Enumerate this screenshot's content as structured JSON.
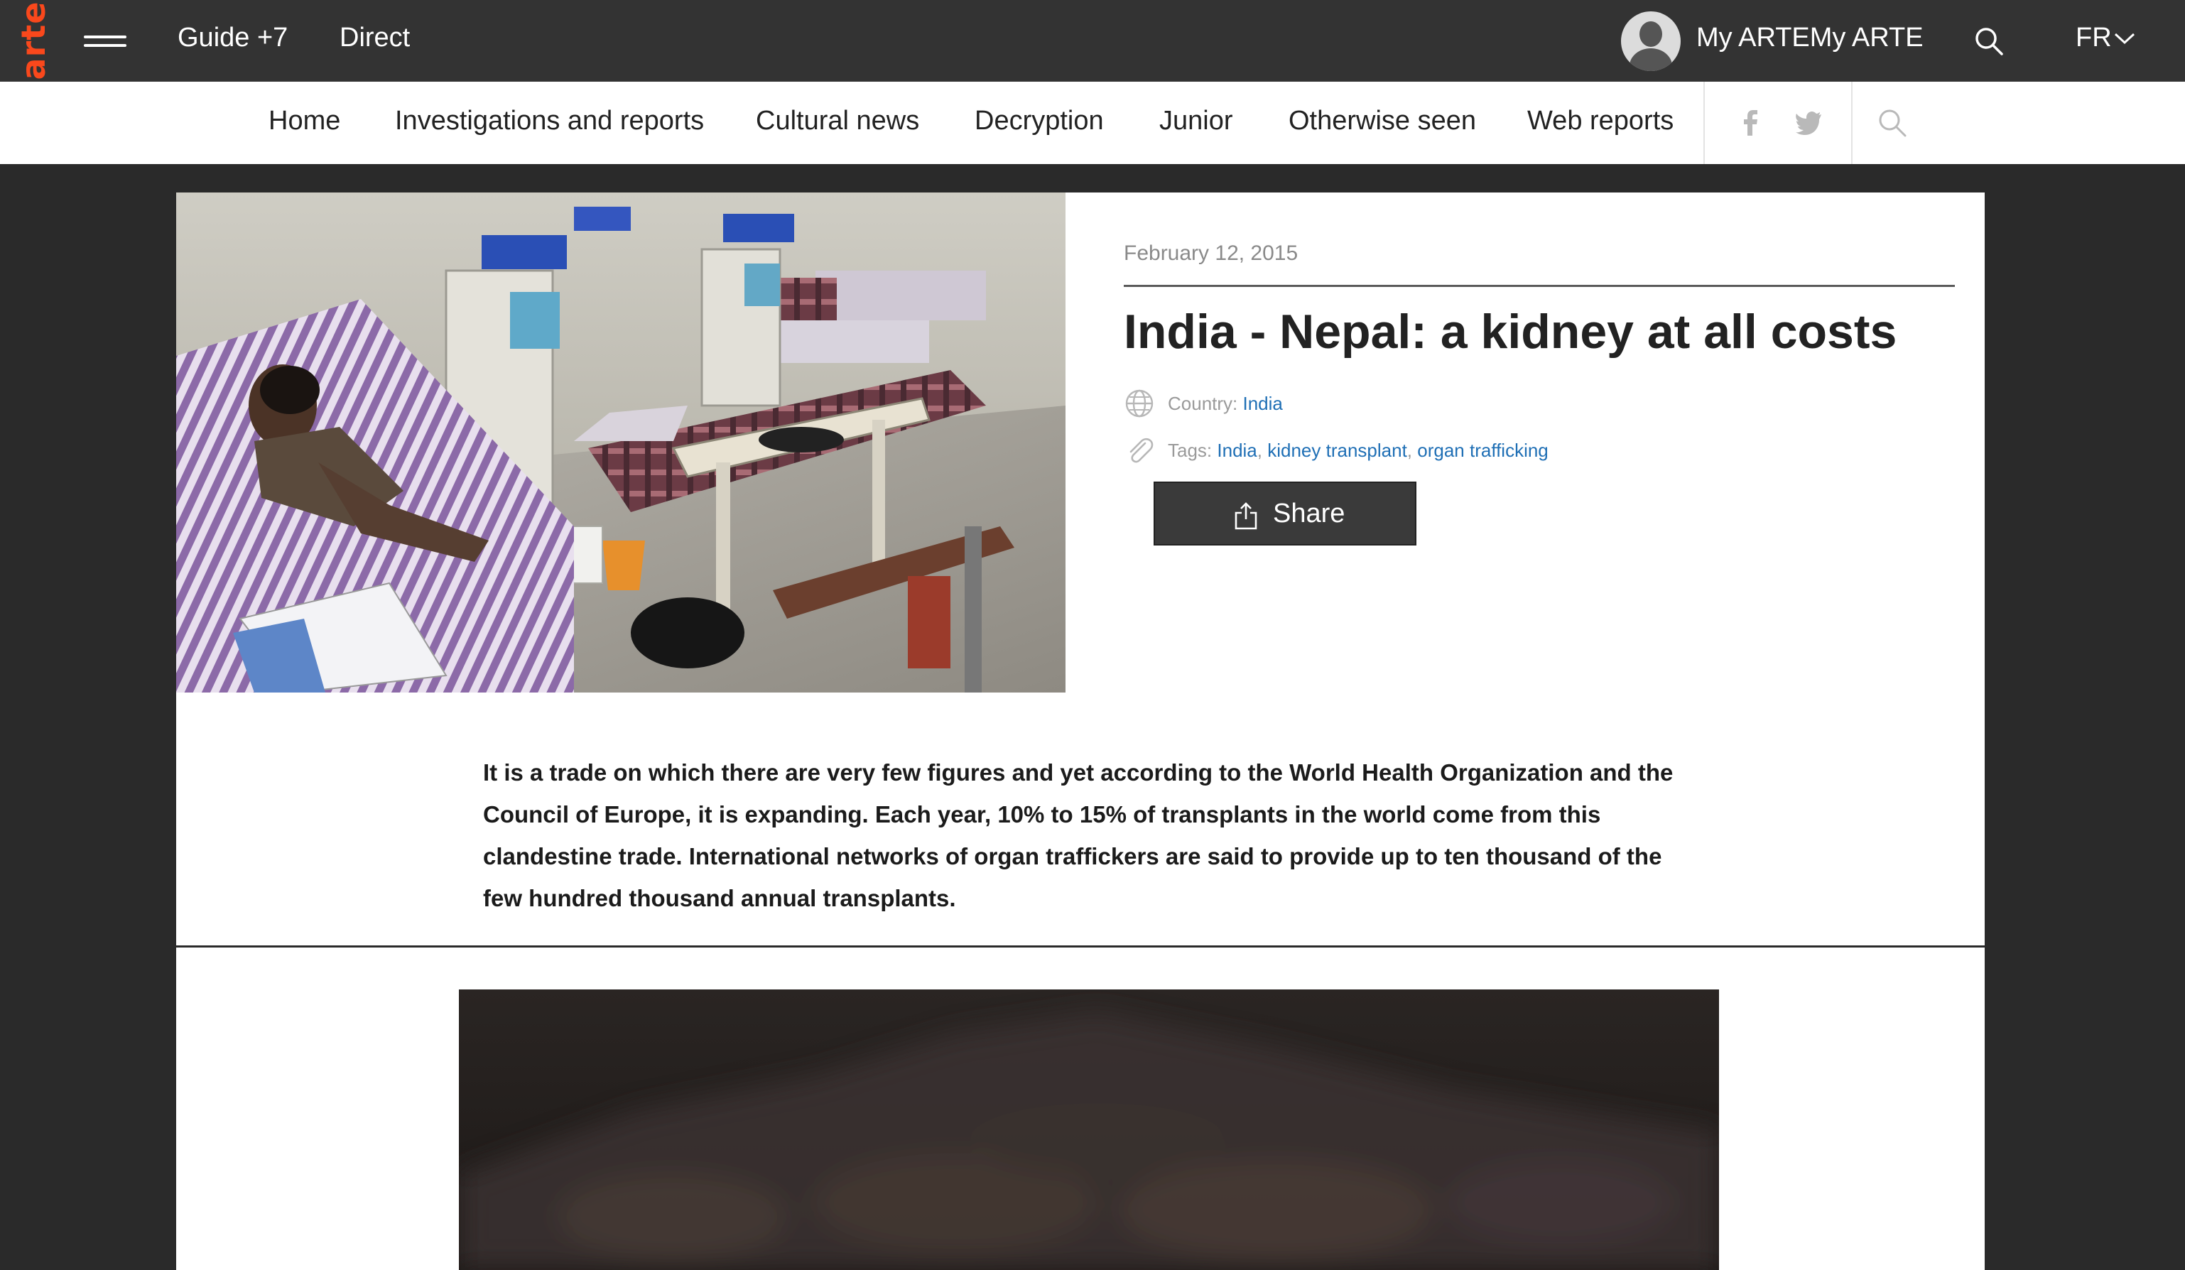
{
  "topbar": {
    "logo": "arte",
    "menu_icon": "hamburger-menu-icon",
    "guide": "Guide +7",
    "direct": "Direct",
    "account": "My ARTEMy ARTE",
    "search_icon": "search-icon",
    "language": "FR"
  },
  "nav": {
    "items": [
      {
        "label": "Home"
      },
      {
        "label": "Investigations and reports"
      },
      {
        "label": "Cultural news"
      },
      {
        "label": "Decryption"
      },
      {
        "label": "Junior"
      },
      {
        "label": "Otherwise seen"
      },
      {
        "label": "Web reports"
      }
    ],
    "icons": [
      "facebook-icon",
      "twitter-icon",
      "search-icon"
    ]
  },
  "article": {
    "date": "February 12, 2015",
    "title": "India - Nepal: a kidney at all costs",
    "country_label": "Country:",
    "country": "India",
    "tags_label": "Tags:",
    "tags": [
      "India",
      "kidney transplant",
      "organ trafficking"
    ],
    "share": "Share",
    "body": "It is a trade on which there are very few figures and yet according to the World Health Organization and the Council of Europe, it is expanding. Each year, 10% to 15% of transplants in the world come from this clandestine trade. International networks of organ traffickers are said to provide up to ten thousand of the few hundred thousand annual transplants."
  },
  "colors": {
    "brand": "#fa481c",
    "link": "#1f6fb5",
    "topbar": "#333333",
    "page_background": "#2a2a2a"
  }
}
